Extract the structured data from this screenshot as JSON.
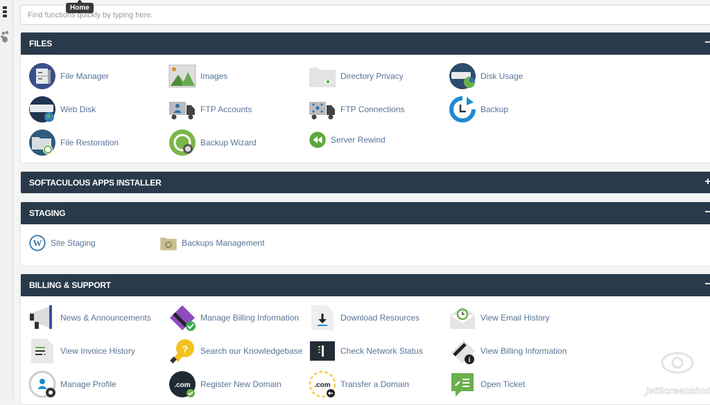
{
  "sidebar": {
    "items": [
      {
        "icon": "grid-menu-icon"
      },
      {
        "icon": "paw-icon"
      }
    ]
  },
  "tooltip": {
    "text": "Home"
  },
  "search": {
    "placeholder": "Find functions quickly by typing here.",
    "value": ""
  },
  "panels": [
    {
      "title": "FILES",
      "toggle": "−",
      "items": [
        {
          "label": "File Manager",
          "icon": "file-manager-icon"
        },
        {
          "label": "Images",
          "icon": "images-icon"
        },
        {
          "label": "Directory Privacy",
          "icon": "directory-privacy-icon"
        },
        {
          "label": "Disk Usage",
          "icon": "disk-usage-icon"
        },
        {
          "label": "Web Disk",
          "icon": "web-disk-icon"
        },
        {
          "label": "FTP Accounts",
          "icon": "ftp-accounts-icon"
        },
        {
          "label": "FTP Connections",
          "icon": "ftp-connections-icon"
        },
        {
          "label": "Backup",
          "icon": "backup-icon"
        },
        {
          "label": "File Restoration",
          "icon": "file-restoration-icon"
        },
        {
          "label": "Backup Wizard",
          "icon": "backup-wizard-icon"
        },
        {
          "label": "Server Rewind",
          "icon": "server-rewind-icon"
        }
      ]
    },
    {
      "title": "SOFTACULOUS APPS INSTALLER",
      "toggle": "+",
      "items": []
    },
    {
      "title": "STAGING",
      "toggle": "−",
      "items": [
        {
          "label": "Site Staging",
          "icon": "wordpress-icon"
        },
        {
          "label": "Backups Management",
          "icon": "backups-management-icon"
        }
      ]
    },
    {
      "title": "BILLING & SUPPORT",
      "toggle": "−",
      "items": [
        {
          "label": "News & Announcements",
          "icon": "megaphone-icon"
        },
        {
          "label": "Manage Billing Information",
          "icon": "credit-card-check-icon"
        },
        {
          "label": "Download Resources",
          "icon": "download-icon"
        },
        {
          "label": "View Email History",
          "icon": "email-history-icon"
        },
        {
          "label": "View Invoice History",
          "icon": "invoice-icon"
        },
        {
          "label": "Search our Knowledgebase",
          "icon": "lightbulb-question-icon"
        },
        {
          "label": "Check Network Status",
          "icon": "network-status-icon"
        },
        {
          "label": "View Billing Information",
          "icon": "billing-info-icon"
        },
        {
          "label": "Manage Profile",
          "icon": "profile-icon"
        },
        {
          "label": "Register New Domain",
          "icon": "register-domain-icon"
        },
        {
          "label": "Transfer a Domain",
          "icon": "transfer-domain-icon"
        },
        {
          "label": "Open Ticket",
          "icon": "open-ticket-icon"
        }
      ]
    }
  ],
  "watermark": {
    "text": "jetScreenshot"
  }
}
